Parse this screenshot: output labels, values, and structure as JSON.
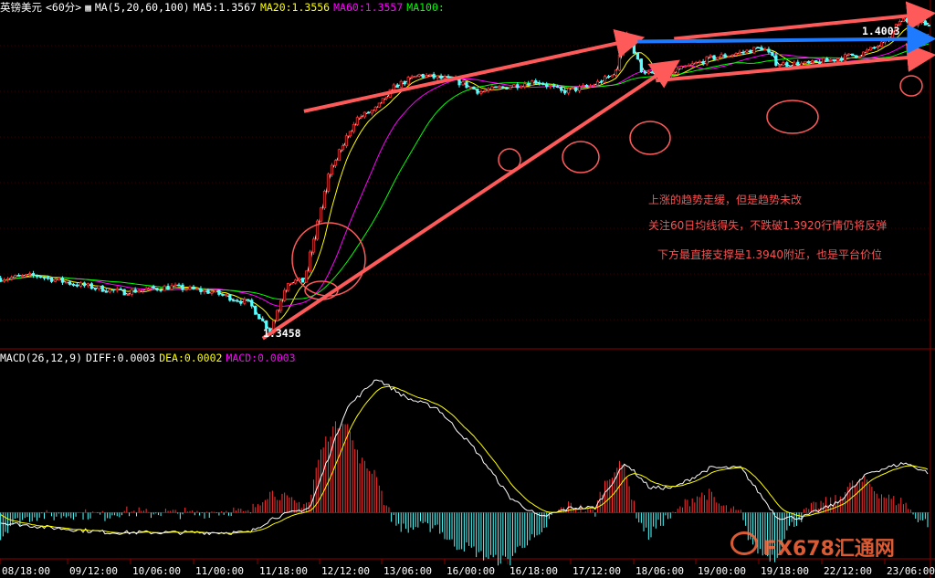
{
  "header": {
    "symbol": "英镑美元",
    "period": "<60分>",
    "ma_title": "MA(5,20,60,100)",
    "ma5": "MA5:1.3567",
    "ma20": "MA20:1.3556",
    "ma60": "MA60:1.3557",
    "ma100": "MA100:"
  },
  "macd_header": {
    "title": "MACD(26,12,9)",
    "diff": "DIFF:0.0003",
    "dea": "DEA:0.0002",
    "macd": "MACD:0.0003"
  },
  "annotations": {
    "line1": "上涨的趋势走缓，但是趋势未改",
    "line2": "关注60日均线得失，不跌破1.3920行情仍将反弹",
    "line3": "下方最直接支撑是1.3940附近，也是平台价位"
  },
  "price_labels": {
    "low": "1.3458",
    "high": "1.4003"
  },
  "watermark": "FX678汇通网",
  "colors": {
    "up_candle": "#ff3232",
    "down_candle": "#54ffff",
    "ma5": "#ffffff",
    "ma20": "#ffff00",
    "ma60": "#ff00ff",
    "ma100": "#00ff00",
    "annotation": "#ff5a5a",
    "blue_arrow": "#1e7bff"
  },
  "chart_data": {
    "type": "candlestick",
    "x_tick_labels": [
      "08/18:00",
      "09/12:00",
      "10/06:00",
      "11/00:00",
      "11/18:00",
      "12/12:00",
      "13/06:00",
      "16/00:00",
      "16/18:00",
      "17/12:00",
      "18/06:00",
      "19/00:00",
      "19/18:00",
      "22/12:00",
      "23/06:00"
    ],
    "price_keypoints": [
      {
        "t": 0,
        "p": 1.356
      },
      {
        "t": 30,
        "p": 1.3565
      },
      {
        "t": 60,
        "p": 1.355
      },
      {
        "t": 100,
        "p": 1.3535
      },
      {
        "t": 140,
        "p": 1.3545
      },
      {
        "t": 175,
        "p": 1.3535
      },
      {
        "t": 205,
        "p": 1.3515
      },
      {
        "t": 222,
        "p": 1.3465
      },
      {
        "t": 236,
        "p": 1.3555
      },
      {
        "t": 250,
        "p": 1.3555
      },
      {
        "t": 270,
        "p": 1.3745
      },
      {
        "t": 292,
        "p": 1.3845
      },
      {
        "t": 310,
        "p": 1.3865
      },
      {
        "t": 325,
        "p": 1.3905
      },
      {
        "t": 345,
        "p": 1.3925
      },
      {
        "t": 375,
        "p": 1.3915
      },
      {
        "t": 395,
        "p": 1.3895
      },
      {
        "t": 420,
        "p": 1.3905
      },
      {
        "t": 442,
        "p": 1.3915
      },
      {
        "t": 462,
        "p": 1.3895
      },
      {
        "t": 486,
        "p": 1.3905
      },
      {
        "t": 505,
        "p": 1.3925
      },
      {
        "t": 516,
        "p": 1.3995
      },
      {
        "t": 528,
        "p": 1.3935
      },
      {
        "t": 545,
        "p": 1.3915
      },
      {
        "t": 560,
        "p": 1.3935
      },
      {
        "t": 585,
        "p": 1.3955
      },
      {
        "t": 610,
        "p": 1.3965
      },
      {
        "t": 628,
        "p": 1.3975
      },
      {
        "t": 640,
        "p": 1.3945
      },
      {
        "t": 668,
        "p": 1.3945
      },
      {
        "t": 690,
        "p": 1.3955
      },
      {
        "t": 712,
        "p": 1.3965
      },
      {
        "t": 730,
        "p": 1.3985
      },
      {
        "t": 742,
        "p": 1.4025
      },
      {
        "t": 765,
        "p": 1.4015
      }
    ],
    "macd_keypoints": [
      {
        "t": 0,
        "v": -0.0002
      },
      {
        "t": 40,
        "v": -0.0003
      },
      {
        "t": 90,
        "v": -0.0004
      },
      {
        "t": 150,
        "v": -0.0004
      },
      {
        "t": 205,
        "v": -0.0004
      },
      {
        "t": 225,
        "v": -0.0001
      },
      {
        "t": 255,
        "v": 0.0001
      },
      {
        "t": 285,
        "v": 0.0021
      },
      {
        "t": 310,
        "v": 0.0027
      },
      {
        "t": 335,
        "v": 0.0023
      },
      {
        "t": 360,
        "v": 0.0021
      },
      {
        "t": 390,
        "v": 0.0013
      },
      {
        "t": 420,
        "v": 0.0003
      },
      {
        "t": 445,
        "v": -0.0001
      },
      {
        "t": 470,
        "v": 0.0001
      },
      {
        "t": 490,
        "v": 0.0001
      },
      {
        "t": 515,
        "v": 0.001
      },
      {
        "t": 535,
        "v": 0.0005
      },
      {
        "t": 555,
        "v": 0.0005
      },
      {
        "t": 585,
        "v": 0.0009
      },
      {
        "t": 610,
        "v": 0.0009
      },
      {
        "t": 640,
        "v": -0.0001
      },
      {
        "t": 660,
        "v": -0.0001
      },
      {
        "t": 690,
        "v": 0.0002
      },
      {
        "t": 715,
        "v": 0.0008
      },
      {
        "t": 745,
        "v": 0.001
      },
      {
        "t": 765,
        "v": 0.0008
      }
    ],
    "price_axis": {
      "min": 1.344,
      "max": 1.404
    },
    "macd_axis": {
      "min": -0.0008,
      "max": 0.003
    },
    "trend_lines": [
      {
        "name": "upper-channel",
        "from": {
          "t": 250,
          "p": 1.386
        },
        "to": {
          "t": 525,
          "p": 1.399
        }
      },
      {
        "name": "lower-channel",
        "from": {
          "t": 216,
          "p": 1.3452
        },
        "to": {
          "t": 555,
          "p": 1.3945
        }
      },
      {
        "name": "upper-channel-2",
        "from": {
          "t": 555,
          "p": 1.399
        },
        "to": {
          "t": 765,
          "p": 1.4035
        }
      },
      {
        "name": "lower-channel-2",
        "from": {
          "t": 540,
          "p": 1.3915
        },
        "to": {
          "t": 765,
          "p": 1.396
        }
      },
      {
        "name": "blue-resistance",
        "from": {
          "t": 525,
          "p": 1.3985
        },
        "to": {
          "t": 765,
          "p": 1.399
        }
      }
    ]
  }
}
